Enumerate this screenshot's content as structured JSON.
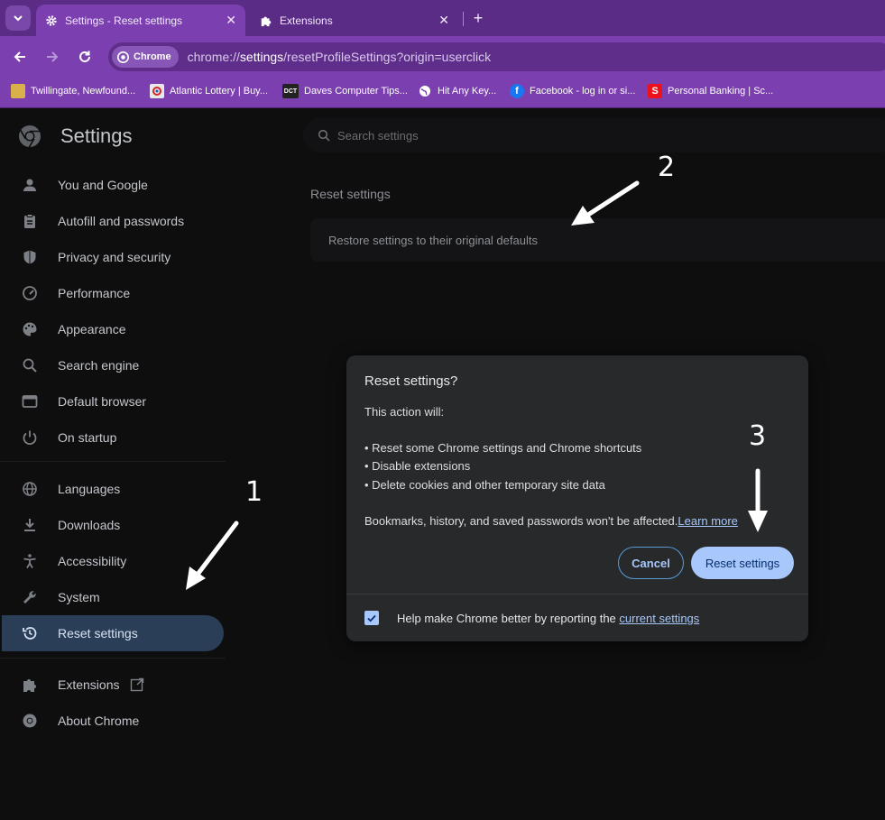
{
  "browser": {
    "tabs": [
      {
        "title": "Settings - Reset settings",
        "icon": "gear-icon",
        "active": true
      },
      {
        "title": "Extensions",
        "icon": "puzzle-icon",
        "active": false
      }
    ],
    "close_glyph": "✕",
    "new_tab_glyph": "+",
    "omnibox": {
      "chip_label": "Chrome",
      "url_prefix": "chrome://",
      "url_bold": "settings",
      "url_rest": "/resetProfileSettings?origin=userclick"
    },
    "bookmarks": [
      {
        "label": "Twillingate, Newfound...",
        "icon": "twillingate-favicon",
        "icon_text": "",
        "color": "#d9b04a"
      },
      {
        "label": "Atlantic Lottery | Buy...",
        "icon": "atlantic-lottery-favicon",
        "icon_text": "",
        "color": "#e8e8e8"
      },
      {
        "label": "Daves Computer Tips...",
        "icon": "dct-favicon",
        "icon_text": "DCT",
        "color": "#222222"
      },
      {
        "label": "Hit Any Key...",
        "icon": "globe-favicon",
        "icon_text": "",
        "color": "#ffffff"
      },
      {
        "label": "Facebook - log in or si...",
        "icon": "facebook-favicon",
        "icon_text": "f",
        "color": "#1877f2"
      },
      {
        "label": "Personal Banking | Sc...",
        "icon": "scotiabank-favicon",
        "icon_text": "S",
        "color": "#ec111a"
      }
    ]
  },
  "settings": {
    "brand": "Settings",
    "search_placeholder": "Search settings",
    "nav": [
      {
        "label": "You and Google",
        "icon": "person-icon"
      },
      {
        "label": "Autofill and passwords",
        "icon": "clipboard-icon"
      },
      {
        "label": "Privacy and security",
        "icon": "shield-icon"
      },
      {
        "label": "Performance",
        "icon": "speedometer-icon"
      },
      {
        "label": "Appearance",
        "icon": "palette-icon"
      },
      {
        "label": "Search engine",
        "icon": "search-icon"
      },
      {
        "label": "Default browser",
        "icon": "browser-window-icon"
      },
      {
        "label": "On startup",
        "icon": "power-icon"
      },
      {
        "label": "Languages",
        "icon": "globe-icon"
      },
      {
        "label": "Downloads",
        "icon": "download-icon"
      },
      {
        "label": "Accessibility",
        "icon": "accessibility-icon"
      },
      {
        "label": "System",
        "icon": "wrench-icon"
      },
      {
        "label": "Reset settings",
        "icon": "history-icon",
        "active": true
      },
      {
        "label": "Extensions",
        "icon": "puzzle-icon"
      },
      {
        "label": "About Chrome",
        "icon": "chrome-icon"
      }
    ],
    "section_title": "Reset settings",
    "card_label": "Restore settings to their original defaults"
  },
  "dialog": {
    "title": "Reset settings?",
    "intro": "This action will:",
    "bullets": [
      "• Reset some Chrome settings and Chrome shortcuts",
      "• Disable extensions",
      "• Delete cookies and other temporary site data"
    ],
    "note": "Bookmarks, history, and saved passwords won't be affected.",
    "note_link": "Learn more",
    "cancel_label": "Cancel",
    "reset_label": "Reset settings",
    "checkbox_checked": true,
    "checkbox_label": "Help make Chrome better by reporting the ",
    "checkbox_link": "current settings"
  },
  "annotations": {
    "numbers": [
      "1",
      "2",
      "3"
    ],
    "color": "#ffffff"
  }
}
